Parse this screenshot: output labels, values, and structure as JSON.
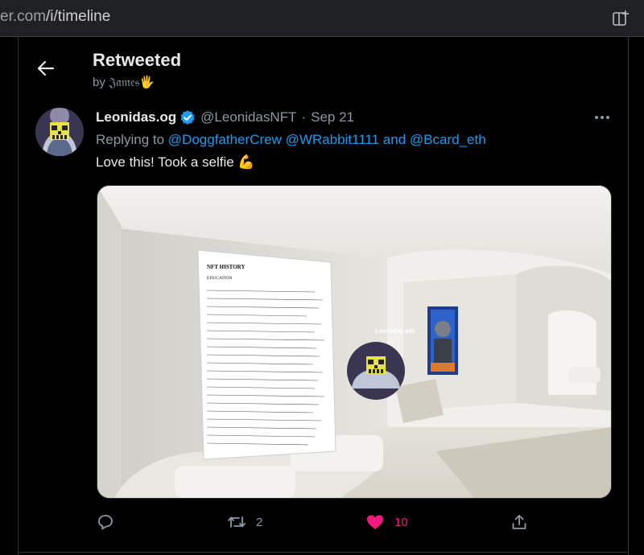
{
  "browser": {
    "url_dim": "er.com",
    "url_path": "/i/timeline",
    "tabs_icon": "tab-actions-icon"
  },
  "header": {
    "back_icon": "arrow-left-icon",
    "title": "Retweeted",
    "subtitle": "by 𝔍𝔞𝔪𝔢𝔰",
    "subtitle_emoji": "🖐"
  },
  "tweet": {
    "display_name": "Leonidas.og",
    "handle": "@LeonidasNFT",
    "separator": "·",
    "date": "Sep 21",
    "replying_prefix": "Replying to",
    "mentions": [
      "@DoggfatherCrew",
      "@WRabbit1111",
      "@Bcard_eth"
    ],
    "and_word": "and",
    "text": "Love this! Took a selfie",
    "text_emoji": "💪",
    "media": {
      "avatar_label": "Leonidas.eth",
      "doc_title": "NFT HISTORY",
      "doc_subtitle": "EDUCATION"
    },
    "actions": {
      "reply_count": "",
      "retweet_count": "2",
      "like_count": "10"
    }
  },
  "colors": {
    "accent": "#1d9bf0",
    "like": "#f91880",
    "muted": "#8b98a5"
  }
}
